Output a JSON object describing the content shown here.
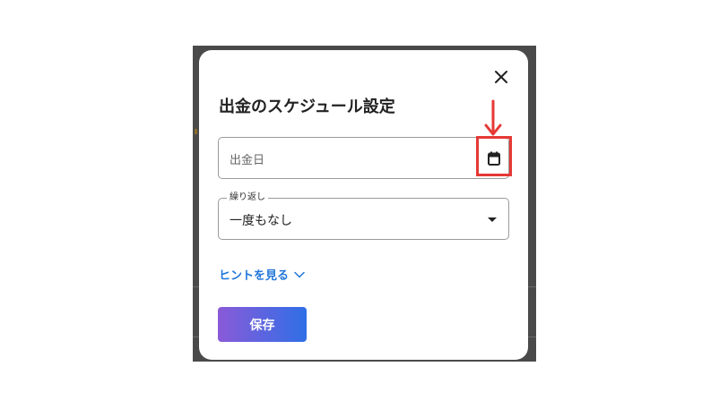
{
  "dialog": {
    "title": "出金のスケジュール設定",
    "close_icon": "close-icon",
    "date_field": {
      "placeholder": "出金日",
      "icon": "calendar-icon"
    },
    "repeat_field": {
      "label": "繰り返し",
      "value": "一度もなし",
      "icon": "caret-down-icon"
    },
    "hint_link": {
      "label": "ヒントを見る",
      "icon": "chevron-down-icon"
    },
    "save_label": "保存"
  },
  "annotation": {
    "color": "#e53935",
    "target": "calendar-icon"
  },
  "colors": {
    "accent_link": "#2176d9",
    "button_gradient_start": "#8a5ad8",
    "button_gradient_end": "#2f6fe6",
    "overlay": "#4a4a4a"
  }
}
